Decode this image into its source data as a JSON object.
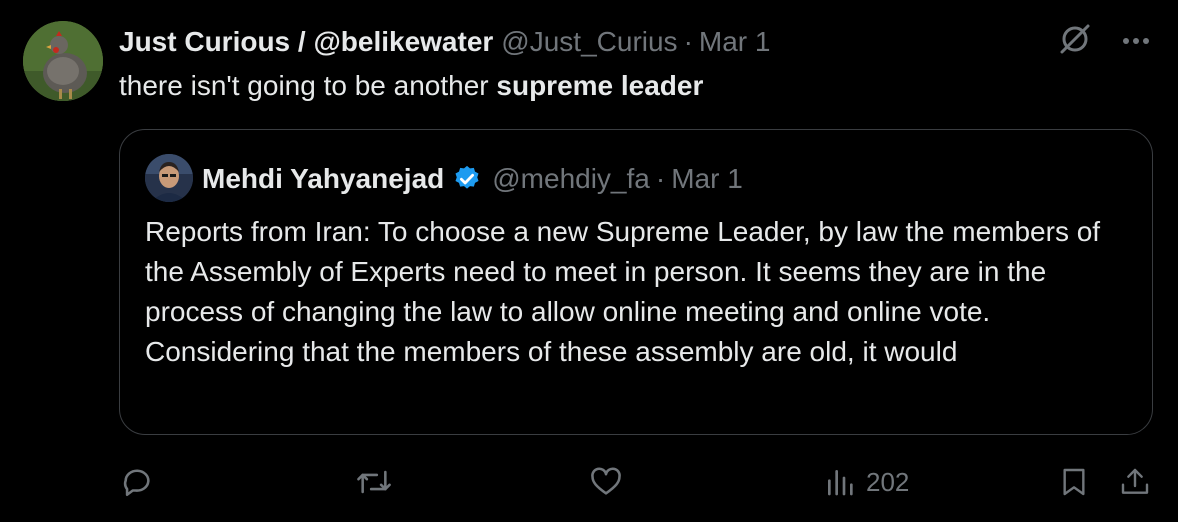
{
  "author": {
    "display_name": "Just Curious / @belikewater",
    "handle": "@Just_Curius",
    "date": "Mar 1",
    "avatar_icon": "chicken-photo-avatar"
  },
  "tweet": {
    "text_plain": "there isn't going to be another ",
    "text_bold": "supreme leader"
  },
  "quoted": {
    "display_name": "Mehdi Yahyanejad",
    "handle": "@mehdiy_fa",
    "date": "Mar 1",
    "verified": true,
    "verified_color": "#1d9bf0",
    "text": "Reports from Iran: To choose a new Supreme Leader, by law the members of the Assembly of Experts need to meet in person. It seems they are in the process of changing the law to allow online meeting and online vote. Considering that the members of these assembly are old, it would"
  },
  "separator": "·",
  "actions": {
    "reply_icon": "reply-icon",
    "retweet_icon": "retweet-icon",
    "like_icon": "like-icon",
    "views_icon": "views-icon",
    "views_count": "202",
    "bookmark_icon": "bookmark-icon",
    "share_icon": "share-icon"
  },
  "colors": {
    "background": "#000000",
    "text_primary": "#e7e9ea",
    "text_secondary": "#71767b",
    "border": "#3a3d41"
  }
}
